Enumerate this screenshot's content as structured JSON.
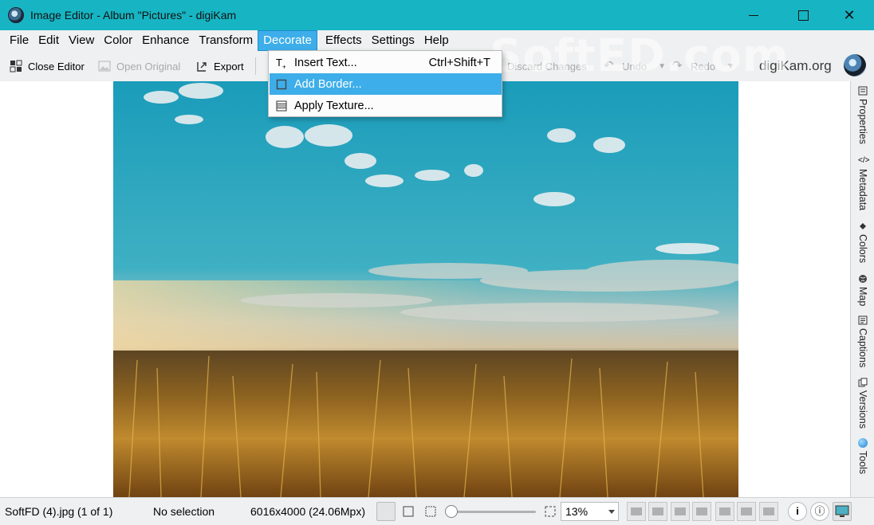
{
  "window": {
    "title": "Image Editor - Album \"Pictures\" - digiKam"
  },
  "menubar": {
    "file": "File",
    "edit": "Edit",
    "view": "View",
    "color": "Color",
    "enhance": "Enhance",
    "transform": "Transform",
    "decorate": "Decorate",
    "effects": "Effects",
    "settings": "Settings",
    "help": "Help"
  },
  "toolbar": {
    "close_editor": "Close Editor",
    "open_original": "Open Original",
    "export": "Export",
    "discard_changes": "Discard Changes",
    "undo": "Undo",
    "redo": "Redo",
    "brand": "digiKam.org"
  },
  "decorate_menu": {
    "insert_text": "Insert Text...",
    "insert_text_shortcut": "Ctrl+Shift+T",
    "add_border": "Add Border...",
    "apply_texture": "Apply Texture..."
  },
  "right_sidebar": {
    "properties": "Properties",
    "metadata": "Metadata",
    "colors": "Colors",
    "map": "Map",
    "captions": "Captions",
    "versions": "Versions",
    "tools": "Tools"
  },
  "statusbar": {
    "filename": "SoftFD (4).jpg (1 of 1)",
    "selection": "No selection",
    "dimensions": "6016x4000 (24.06Mpx)",
    "zoom": "13%",
    "zoom_slider_fraction": 0.05
  },
  "watermark": "SoftED.com",
  "colors": {
    "titlebar": "#17b5c3",
    "accent": "#3daee9"
  }
}
